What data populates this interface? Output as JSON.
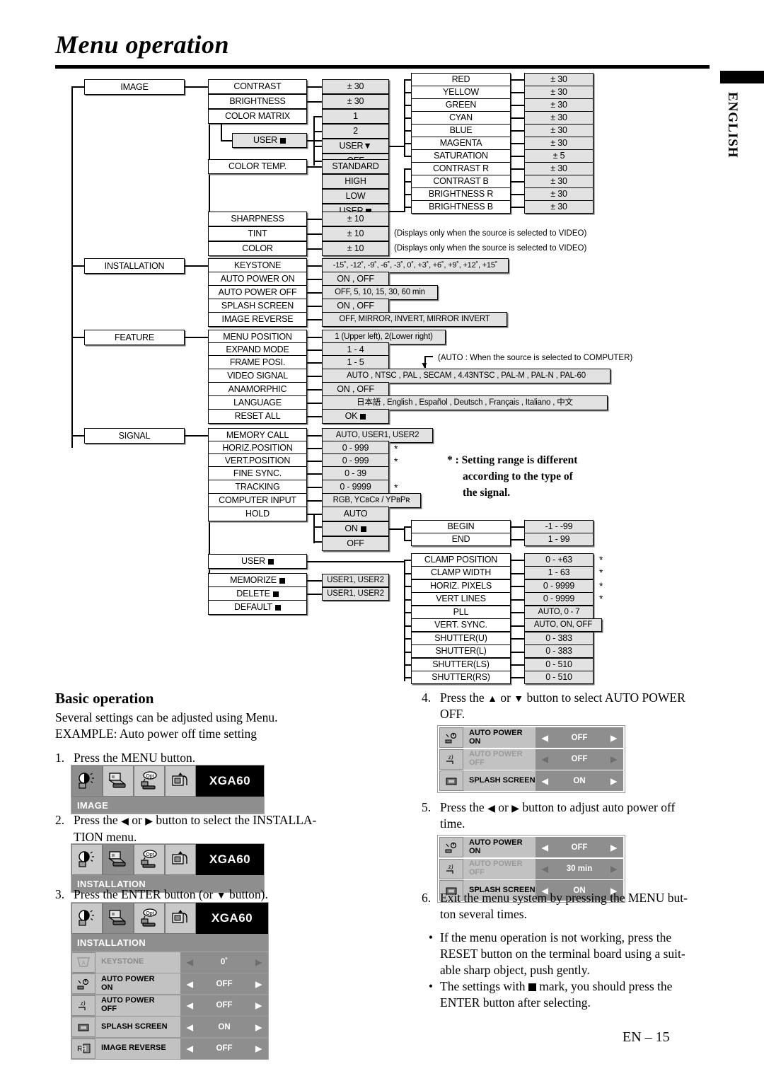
{
  "page": {
    "title": "Menu operation",
    "side_tab": "ENGLISH",
    "footer": "EN – 15"
  },
  "diagram": {
    "menus": [
      {
        "label": "IMAGE"
      },
      {
        "label": "INSTALLATION"
      },
      {
        "label": "FEATURE"
      },
      {
        "label": "SIGNAL"
      }
    ],
    "image_items": [
      {
        "label": "CONTRAST",
        "value": "± 30"
      },
      {
        "label": "BRIGHTNESS",
        "value": "± 30"
      },
      {
        "label": "COLOR MATRIX",
        "value": ""
      },
      {
        "label": "COLOR TEMP.",
        "value": ""
      },
      {
        "label": "SHARPNESS",
        "value": "± 10"
      },
      {
        "label": "TINT",
        "value": "± 10"
      },
      {
        "label": "COLOR",
        "value": "± 10"
      }
    ],
    "color_matrix_user": "USER",
    "color_matrix_values": [
      "1",
      "2",
      "USER▼",
      "OFF"
    ],
    "color_temp_values": [
      "STANDARD",
      "HIGH",
      "LOW",
      "USER"
    ],
    "color_matrix_sub": [
      {
        "label": "RED",
        "value": "± 30"
      },
      {
        "label": "YELLOW",
        "value": "± 30"
      },
      {
        "label": "GREEN",
        "value": "± 30"
      },
      {
        "label": "CYAN",
        "value": "± 30"
      },
      {
        "label": "BLUE",
        "value": "± 30"
      },
      {
        "label": "MAGENTA",
        "value": "± 30"
      },
      {
        "label": "SATURATION",
        "value": "± 5"
      }
    ],
    "color_temp_sub": [
      {
        "label": "CONTRAST R",
        "value": "± 30"
      },
      {
        "label": "CONTRAST B",
        "value": "± 30"
      },
      {
        "label": "BRIGHTNESS R",
        "value": "± 30"
      },
      {
        "label": "BRIGHTNESS B",
        "value": "± 30"
      }
    ],
    "video_note_tint": "(Displays only when the source is selected to VIDEO)",
    "video_note_color": "(Displays only when the source is selected to VIDEO)",
    "installation_items": [
      {
        "label": "KEYSTONE",
        "value": "-15˚, -12˚, -9˚, -6˚, -3˚, 0˚, +3˚, +6˚, +9˚, +12˚, +15˚"
      },
      {
        "label": "AUTO POWER ON",
        "value": "ON , OFF"
      },
      {
        "label": "AUTO POWER OFF",
        "value": "OFF, 5, 10, 15, 30, 60 min"
      },
      {
        "label": "SPLASH SCREEN",
        "value": "ON , OFF"
      },
      {
        "label": "IMAGE REVERSE",
        "value": "OFF, MIRROR, INVERT, MIRROR INVERT"
      }
    ],
    "feature_items": [
      {
        "label": "MENU POSITION",
        "value": "1 (Upper left), 2(Lower right)"
      },
      {
        "label": "EXPAND MODE",
        "value": "1 - 4"
      },
      {
        "label": "FRAME POSI.",
        "value": "1 - 5"
      },
      {
        "label": "VIDEO SIGNAL",
        "value": "AUTO , NTSC , PAL , SECAM , 4.43NTSC , PAL-M , PAL-N , PAL-60"
      },
      {
        "label": "ANAMORPHIC",
        "value": "ON , OFF"
      },
      {
        "label": "LANGUAGE",
        "value": "日本語 , English , Español , Deutsch , Français , Italiano , 中文"
      },
      {
        "label": "RESET ALL",
        "value": "OK"
      }
    ],
    "auto_note": "(AUTO : When the source is selected to COMPUTER)",
    "signal_items": [
      {
        "label": "MEMORY CALL",
        "value": "AUTO, USER1, USER2",
        "star": false
      },
      {
        "label": "HORIZ.POSITION",
        "value": "0 - 999",
        "star": true
      },
      {
        "label": "VERT.POSITION",
        "value": "0 - 999",
        "star": true
      },
      {
        "label": "FINE SYNC.",
        "value": "0 - 39",
        "star": false
      },
      {
        "label": "TRACKING",
        "value": "0 - 9999",
        "star": true
      },
      {
        "label": "COMPUTER INPUT",
        "value": "RGB, YCʙCʀ / YPʙPʀ",
        "star": false
      },
      {
        "label": "HOLD",
        "value": "",
        "star": false
      }
    ],
    "hold_values": [
      "AUTO",
      "ON",
      "OFF"
    ],
    "hold_sub": [
      {
        "label": "BEGIN",
        "value": "-1 - -99"
      },
      {
        "label": "END",
        "value": "1 - 99"
      }
    ],
    "signal_user": "USER",
    "signal_memorize": "MEMORIZE",
    "signal_delete": "DELETE",
    "signal_default": "DEFAULT",
    "memorize_value": "USER1, USER2",
    "delete_value": "USER1, USER2",
    "user_sub": [
      {
        "label": "CLAMP POSITION",
        "value": "0 - +63",
        "star": true
      },
      {
        "label": "CLAMP WIDTH",
        "value": "1 - 63",
        "star": true
      },
      {
        "label": "HORIZ. PIXELS",
        "value": "0 - 9999",
        "star": true
      },
      {
        "label": "VERT LINES",
        "value": "0 - 9999",
        "star": true
      },
      {
        "label": "PLL",
        "value": "AUTO, 0 - 7",
        "star": false
      },
      {
        "label": "VERT. SYNC.",
        "value": "AUTO, ON, OFF",
        "star": false
      },
      {
        "label": "SHUTTER(U)",
        "value": "0 - 383",
        "star": false
      },
      {
        "label": "SHUTTER(L)",
        "value": "0 - 383",
        "star": false
      },
      {
        "label": "SHUTTER(LS)",
        "value": "0 - 510",
        "star": false
      },
      {
        "label": "SHUTTER(RS)",
        "value": "0 - 510",
        "star": false
      }
    ],
    "star_note_line1": "* : Setting range is different",
    "star_note_line2": "according to the type of",
    "star_note_line3": "the signal."
  },
  "basic": {
    "heading": "Basic operation",
    "intro_line1": "Several settings can be adjusted using Menu.",
    "intro_line2": "EXAMPLE: Auto power off time setting",
    "step1_num": "1.",
    "step1_text": "Press the MENU button.",
    "step2_num": "2.",
    "step2_a": "Press the",
    "step2_b": "or",
    "step2_c": "button to select the INSTALLA-",
    "step2_d": "TION menu.",
    "step3_num": "3.",
    "step3_a": "Press the ENTER button (or",
    "step3_b": "button).",
    "step4_num": "4.",
    "step4_a": "Press the",
    "step4_b": "or",
    "step4_c": "button to select AUTO POWER",
    "step4_d": "OFF.",
    "step5_num": "5.",
    "step5_a": "Press the",
    "step5_b": "or",
    "step5_c": "button to adjust auto power off",
    "step5_d": "time.",
    "step6_num": "6.",
    "step6_a": "Exit the menu system by pressing the MENU but-",
    "step6_b": "ton several times.",
    "bullet1_a": "If the menu operation is not working, press the",
    "bullet1_b": "RESET button on the terminal board using a suit-",
    "bullet1_c": "able sharp object, push gently.",
    "bullet2_a": "The settings with",
    "bullet2_b": "mark, you should press the",
    "bullet2_c": "ENTER button after selecting."
  },
  "osd": {
    "signal_label": "XGA60",
    "menu_image": "IMAGE",
    "menu_installation": "INSTALLATION",
    "rows_installation": [
      {
        "label1": "KEYSTONE",
        "label2": "",
        "value": "0˚",
        "state": "grey",
        "icon": "keystone-icon"
      },
      {
        "label1": "AUTO POWER",
        "label2": "ON",
        "value": "OFF",
        "state": "on",
        "icon": "auto-power-on-icon"
      },
      {
        "label1": "AUTO POWER",
        "label2": "OFF",
        "value": "OFF",
        "state": "on",
        "icon": "auto-power-off-icon"
      },
      {
        "label1": "SPLASH SCREEN",
        "label2": "",
        "value": "ON",
        "state": "on",
        "icon": "splash-screen-icon"
      },
      {
        "label1": "IMAGE REVERSE",
        "label2": "",
        "value": "OFF",
        "state": "on",
        "icon": "image-reverse-icon"
      }
    ],
    "rows_step4": [
      {
        "label1": "AUTO POWER",
        "label2": "ON",
        "value": "OFF",
        "state": "on",
        "icon": "auto-power-on-icon"
      },
      {
        "label1": "AUTO POWER",
        "label2": "OFF",
        "value": "OFF",
        "state": "dim",
        "icon": "auto-power-off-icon"
      },
      {
        "label1": "SPLASH SCREEN",
        "label2": "",
        "value": "ON",
        "state": "on",
        "icon": "splash-screen-icon"
      }
    ],
    "rows_step5": [
      {
        "label1": "AUTO POWER",
        "label2": "ON",
        "value": "OFF",
        "state": "on",
        "icon": "auto-power-on-icon"
      },
      {
        "label1": "AUTO POWER",
        "label2": "OFF",
        "value": "30 min",
        "state": "dim",
        "icon": "auto-power-off-icon"
      },
      {
        "label1": "SPLASH SCREEN",
        "label2": "",
        "value": "ON",
        "state": "on",
        "icon": "splash-screen-icon"
      }
    ],
    "tab_icons": [
      "image-tab-icon",
      "installation-tab-icon",
      "feature-tab-icon",
      "signal-tab-icon"
    ],
    "arrow_left": "◀",
    "arrow_right": "▶"
  }
}
